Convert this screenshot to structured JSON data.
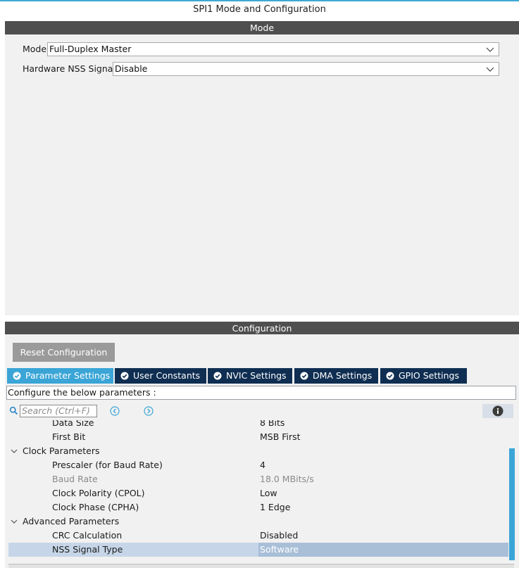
{
  "window": {
    "title": "SPI1 Mode and Configuration"
  },
  "mode": {
    "section_label": "Mode",
    "fields": [
      {
        "label": "Mode",
        "value": "Full-Duplex Master"
      },
      {
        "label": "Hardware NSS Signal",
        "value": "Disable"
      }
    ]
  },
  "configuration": {
    "section_label": "Configuration",
    "reset_label": "Reset Configuration",
    "tabs": [
      {
        "label": "Parameter Settings",
        "active": true
      },
      {
        "label": "User Constants",
        "active": false
      },
      {
        "label": "NVIC Settings",
        "active": false
      },
      {
        "label": "DMA Settings",
        "active": false
      },
      {
        "label": "GPIO Settings",
        "active": false
      }
    ],
    "instructions": "Configure the below parameters :",
    "search": {
      "placeholder": "Search (Ctrl+F)"
    },
    "rows": [
      {
        "name": "Data Size",
        "value": "8 Bits"
      },
      {
        "name": "First Bit",
        "value": "MSB First"
      },
      {
        "group": "Clock Parameters"
      },
      {
        "name": "Prescaler (for Baud Rate)",
        "value": "4"
      },
      {
        "name": "Baud Rate",
        "value": "18.0 MBits/s",
        "disabled": true
      },
      {
        "name": "Clock Polarity (CPOL)",
        "value": "Low"
      },
      {
        "name": "Clock Phase (CPHA)",
        "value": "1 Edge"
      },
      {
        "group": "Advanced Parameters"
      },
      {
        "name": "CRC Calculation",
        "value": "Disabled"
      },
      {
        "name": "NSS Signal Type",
        "value": "Software",
        "selected": true
      }
    ]
  },
  "colors": {
    "accent": "#3aa5d6",
    "tab_inactive": "#0f2e52",
    "section_bar": "#4f4f50",
    "selection": "#c6d6e8"
  },
  "icons": {
    "dropdown": "chevron-down-icon",
    "tab_status": "check-circle-icon",
    "search": "search-icon",
    "prev": "arrow-left-circle-icon",
    "next": "arrow-right-circle-icon",
    "info": "info-icon",
    "group_expander": "chevron-down-icon"
  }
}
